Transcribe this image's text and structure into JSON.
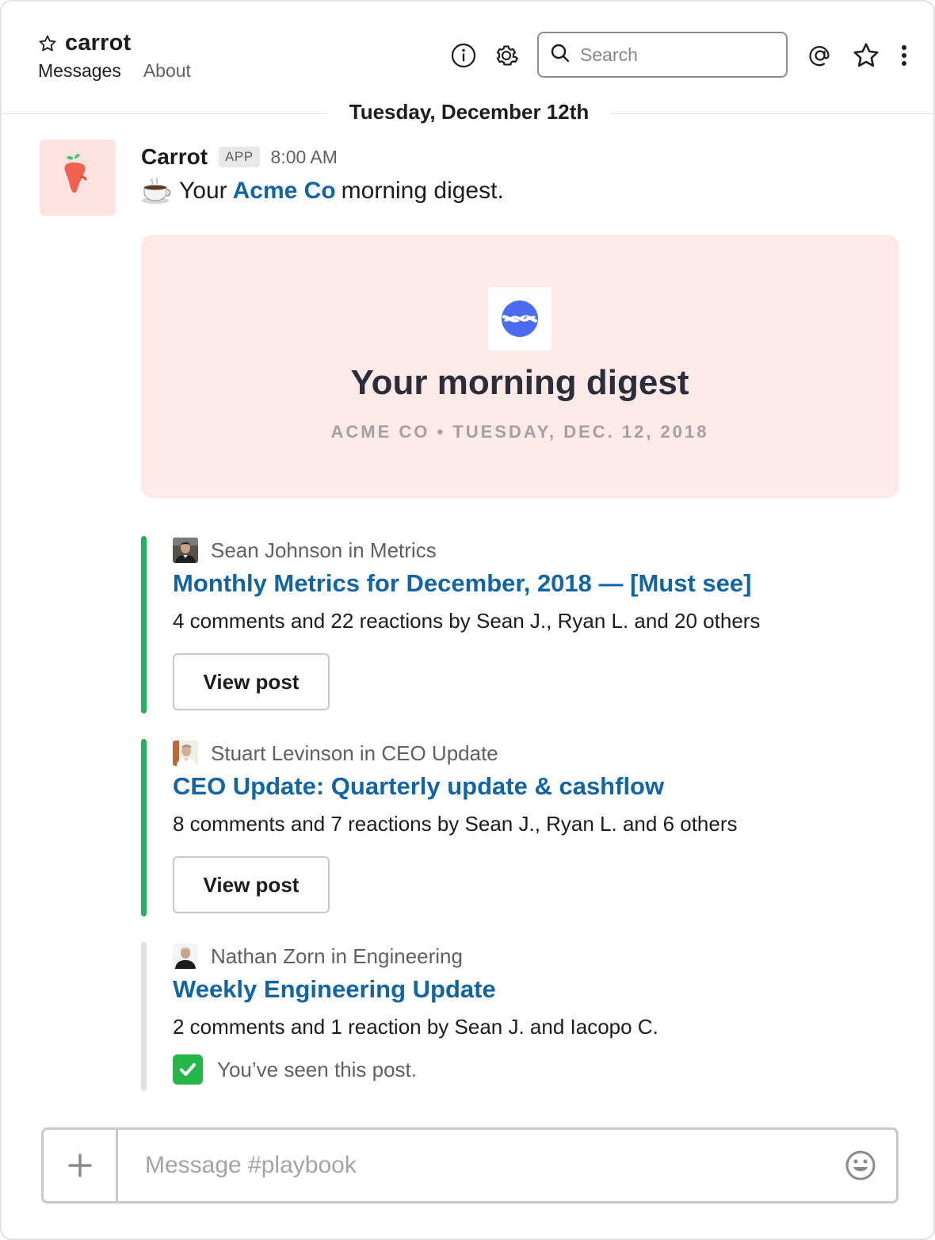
{
  "header": {
    "channel_name": "carrot",
    "tabs": [
      {
        "label": "Messages"
      },
      {
        "label": "About"
      }
    ],
    "search_placeholder": "Search",
    "icons": [
      "info-icon",
      "gear-icon",
      "search-icon",
      "mention-icon",
      "star-icon",
      "more-vertical-icon"
    ]
  },
  "date_divider": "Tuesday, December 12th",
  "message": {
    "sender": "Carrot",
    "badge": "APP",
    "time": "8:00 AM",
    "text_prefix": "Your",
    "text_link": "Acme Co",
    "text_suffix": "morning digest.",
    "emoji": "coffee-cup-icon"
  },
  "digest": {
    "title": "Your morning digest",
    "subtitle": "ACME CO • TUESDAY, DEC. 12, 2018",
    "bg_color": "#fde9e7",
    "logo_color": "#4b6cf0"
  },
  "posts": [
    {
      "author": "Sean Johnson in Metrics",
      "title": "Monthly Metrics for December, 2018 — [Must see]",
      "stats": "4 comments and 22 reactions by Sean J., Ryan L. and 20 others",
      "button": "View post",
      "bar_color": "#2eaa61"
    },
    {
      "author": "Stuart Levinson in CEO Update",
      "title": "CEO Update: Quarterly update & cashflow",
      "stats": "8 comments and 7 reactions by Sean J., Ryan L. and 6 others",
      "button": "View post",
      "bar_color": "#2eaa61"
    },
    {
      "author": "Nathan Zorn in Engineering",
      "title": "Weekly Engineering Update",
      "stats": "2 comments and 1 reaction by Sean J. and Iacopo C.",
      "seen_text": "You’ve seen this post.",
      "bar_color": "#e0e0e0"
    }
  ],
  "composer": {
    "placeholder": "Message #playbook"
  },
  "colors": {
    "link": "#1264a3",
    "accent_green": "#2eaa61",
    "carrot": "#f0624f"
  }
}
